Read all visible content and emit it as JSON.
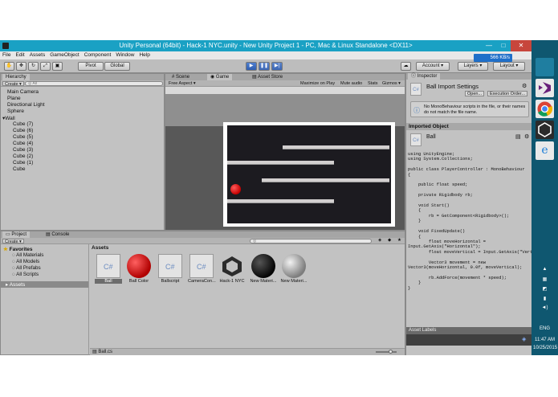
{
  "window": {
    "title": "Unity Personal (64bit) - Hack-1 NYC.unity - New Unity Project 1 - PC, Mac & Linux Standalone <DX11>",
    "min_label": "—",
    "max_label": "□",
    "close_label": "✕"
  },
  "menu": [
    "File",
    "Edit",
    "Assets",
    "GameObject",
    "Component",
    "Window",
    "Help"
  ],
  "toolbar": {
    "pivot_label": "Pivot",
    "global_label": "Global",
    "account_label": "Account",
    "layers_label": "Layers",
    "layout_label": "Layout",
    "network_speed": "566 KB/s"
  },
  "hierarchy": {
    "tab": "Hierarchy",
    "create_label": "Create",
    "search_placeholder": "All",
    "items": [
      {
        "label": "Main Camera",
        "indent": 0
      },
      {
        "label": "Plane",
        "indent": 0
      },
      {
        "label": "Directional Light",
        "indent": 0
      },
      {
        "label": "Sphere",
        "indent": 0
      },
      {
        "label": "Wall",
        "indent": 0,
        "expanded": true
      },
      {
        "label": "Cube (7)",
        "indent": 1
      },
      {
        "label": "Cube (6)",
        "indent": 1
      },
      {
        "label": "Cube (5)",
        "indent": 1
      },
      {
        "label": "Cube (4)",
        "indent": 1
      },
      {
        "label": "Cube (3)",
        "indent": 1
      },
      {
        "label": "Cube (2)",
        "indent": 1
      },
      {
        "label": "Cube (1)",
        "indent": 1
      },
      {
        "label": "Cube",
        "indent": 1
      }
    ]
  },
  "viewport": {
    "tabs": [
      "Scene",
      "Game",
      "Asset Store"
    ],
    "active_tab": "Game",
    "aspect_label": "Free Aspect",
    "toggles": [
      "Maximize on Play",
      "Mute audio",
      "Stats",
      "Gizmos"
    ]
  },
  "inspector": {
    "tab": "Inspector",
    "title": "Ball Import Settings",
    "open_label": "Open...",
    "exec_order_label": "Execution Order...",
    "warning": "No MonoBehaviour scripts in the file, or their names do not match the file name.",
    "imported_header": "Imported Object",
    "object_name": "Ball",
    "code": "using UnityEngine;\nusing System.Collections;\n\npublic class PlayerController : MonoBehaviour\n{\n\n    public float speed;\n\n    private Rigidbody rb;\n\n    void Start()\n    {\n        rb = GetComponent<Rigidbody>();\n    }\n\n    void FixedUpdate()\n    {\n        float moveHorizontal =\nInput.GetAxis(\"Horizontal\");\n        float moveVertical = Input.GetAxis(\"Vertical\");\n\n        Vector3 movement = new\nVector3(moveHorizontal, 0.0f, moveVertical);\n\n        rb.AddForce(movement * speed);\n    }\n}",
    "asset_labels": "Asset Labels"
  },
  "project": {
    "tabs": [
      "Project",
      "Console"
    ],
    "create_label": "Create",
    "favorites_label": "Favorites",
    "favorites": [
      "All Materials",
      "All Models",
      "All Prefabs",
      "All Scripts"
    ],
    "assets_root": "Assets",
    "assets_header": "Assets",
    "assets": [
      {
        "label": "Ball",
        "kind": "script",
        "selected": true
      },
      {
        "label": "Ball Color",
        "kind": "red-sphere"
      },
      {
        "label": "Ballscript",
        "kind": "script"
      },
      {
        "label": "CameraCon...",
        "kind": "script"
      },
      {
        "label": "Hack-1 NYC",
        "kind": "unity-scene"
      },
      {
        "label": "New Materi...",
        "kind": "black-sphere"
      },
      {
        "label": "New Materi...",
        "kind": "gray-sphere"
      }
    ],
    "status_file": "Ball.cs"
  },
  "taskbar": {
    "language": "ENG",
    "time": "11:47 AM",
    "date": "10/25/2015"
  },
  "colors": {
    "titlebar": "#1aa1c4",
    "play_active": "#3b6fc4",
    "ball_red": "#e11010",
    "taskbar": "#0f5770"
  }
}
